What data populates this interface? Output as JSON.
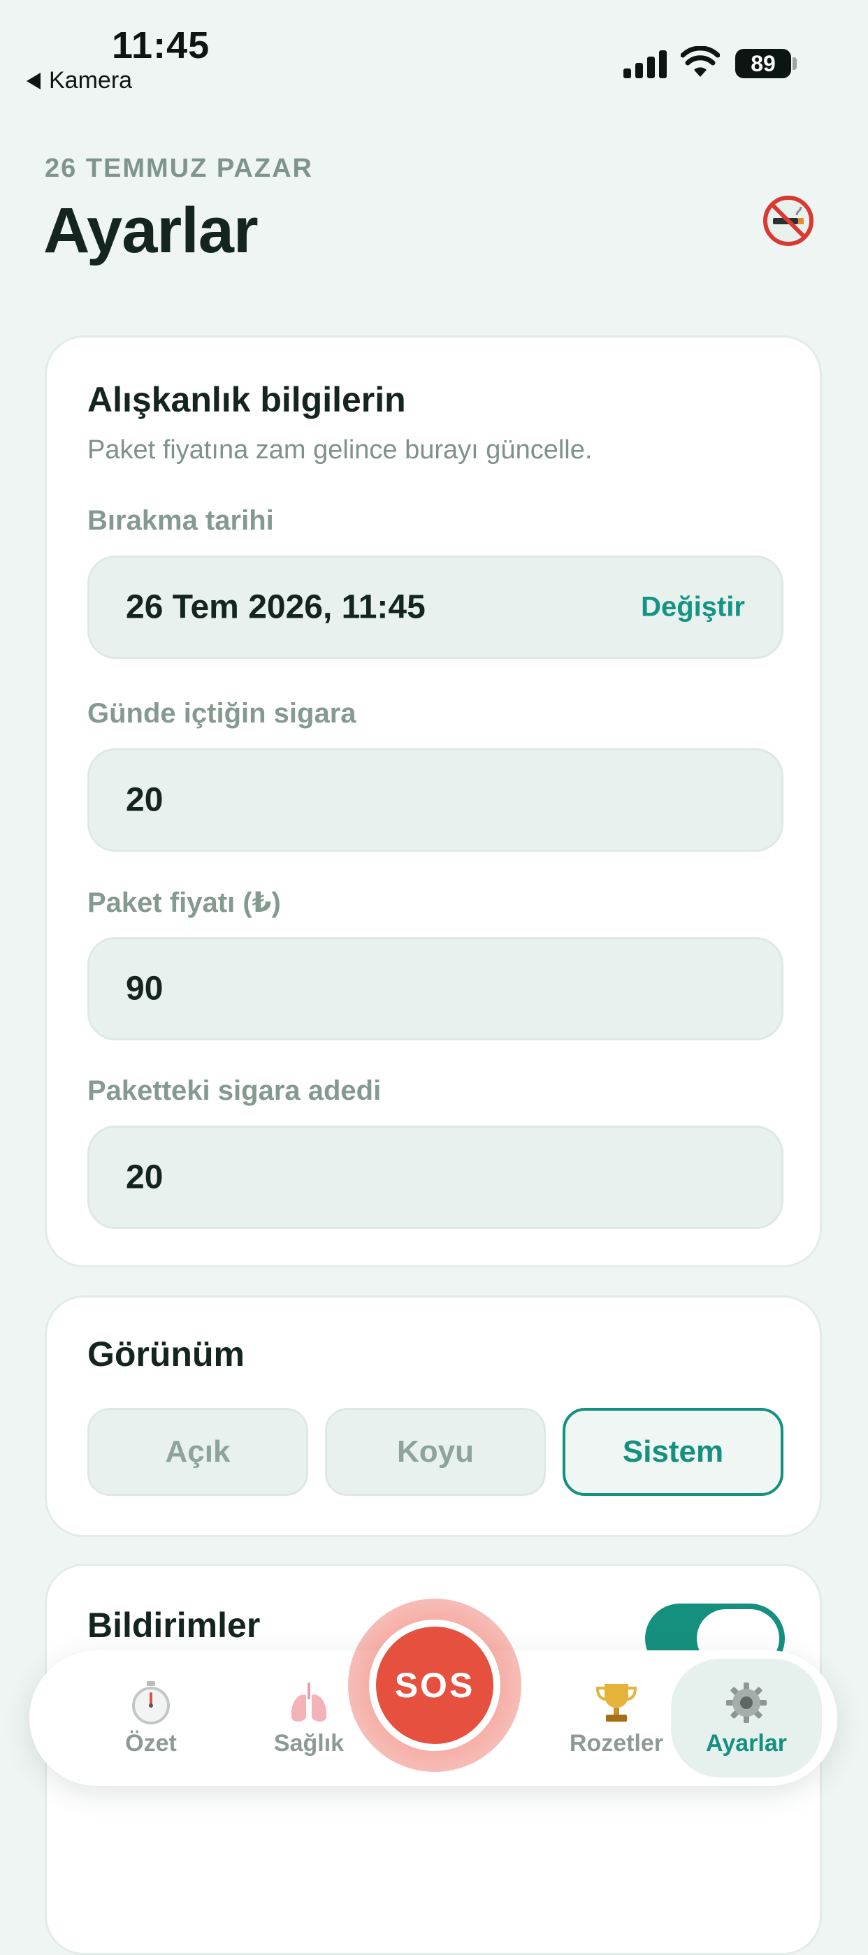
{
  "status_bar": {
    "time": "11:45",
    "back_label": "Kamera",
    "battery": "89"
  },
  "header": {
    "date": "26 TEMMUZ PAZAR",
    "title": "Ayarlar",
    "icon": "no-smoking-icon"
  },
  "habits": {
    "title": "Alışkanlık bilgilerin",
    "subtitle": "Paket fiyatına zam gelince burayı güncelle.",
    "quit_date_label": "Bırakma tarihi",
    "quit_date_value": "26 Tem 2026, 11:45",
    "quit_date_action": "Değiştir",
    "daily_label": "Günde içtiğin sigara",
    "daily_value": "20",
    "price_label": "Paket fiyatı (₺)",
    "price_value": "90",
    "pack_count_label": "Paketteki sigara adedi",
    "pack_count_value": "20"
  },
  "appearance": {
    "title": "Görünüm",
    "options": [
      "Açık",
      "Koyu",
      "Sistem"
    ],
    "selected": "Sistem"
  },
  "notifications": {
    "title": "Bildirimler",
    "enabled": true
  },
  "tabbar": {
    "tabs": [
      {
        "label": "Özet",
        "icon": "stopwatch-icon"
      },
      {
        "label": "Sağlık",
        "icon": "lungs-icon"
      },
      {
        "label": "Rozetler",
        "icon": "trophy-icon"
      },
      {
        "label": "Ayarlar",
        "icon": "gear-icon"
      }
    ],
    "active": "Ayarlar",
    "sos_label": "SOS"
  },
  "colors": {
    "accent": "#15907f",
    "sos": "#e5503f",
    "background": "#eff5f3"
  }
}
